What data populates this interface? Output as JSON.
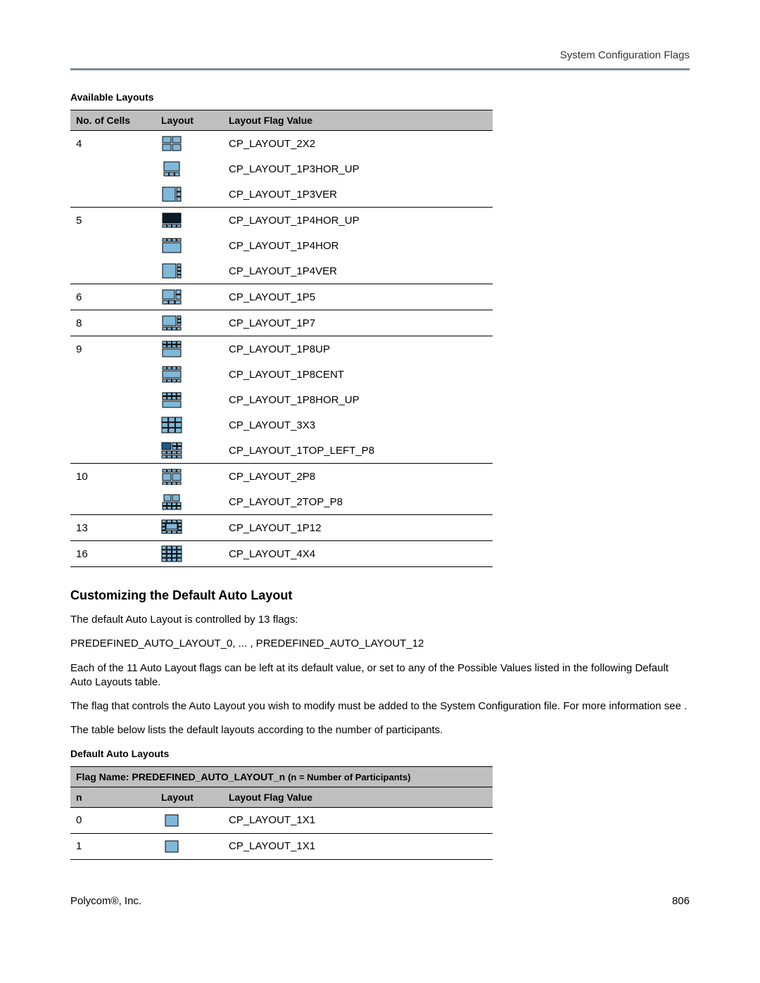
{
  "header": {
    "section": "System Configuration Flags"
  },
  "table1": {
    "caption": "Available Layouts",
    "columns": [
      "No. of Cells",
      "Layout",
      "Layout Flag Value"
    ],
    "rows": [
      {
        "cells": "4",
        "icon": "2x2",
        "value": "CP_LAYOUT_2X2",
        "group_last": false
      },
      {
        "cells": "",
        "icon": "1p3hor_up",
        "value": "CP_LAYOUT_1P3HOR_UP",
        "group_last": false
      },
      {
        "cells": "",
        "icon": "1p3ver",
        "value": "CP_LAYOUT_1P3VER",
        "group_last": true
      },
      {
        "cells": "5",
        "icon": "1p4hor_up",
        "value": "CP_LAYOUT_1P4HOR_UP",
        "group_last": false
      },
      {
        "cells": "",
        "icon": "1p4hor",
        "value": "CP_LAYOUT_1P4HOR",
        "group_last": false
      },
      {
        "cells": "",
        "icon": "1p4ver",
        "value": "CP_LAYOUT_1P4VER",
        "group_last": true
      },
      {
        "cells": "6",
        "icon": "1p5",
        "value": "CP_LAYOUT_1P5",
        "group_last": true
      },
      {
        "cells": "8",
        "icon": "1p7",
        "value": "CP_LAYOUT_1P7",
        "group_last": true
      },
      {
        "cells": "9",
        "icon": "1p8up",
        "value": "CP_LAYOUT_1P8UP",
        "group_last": false
      },
      {
        "cells": "",
        "icon": "1p8cent",
        "value": "CP_LAYOUT_1P8CENT",
        "group_last": false
      },
      {
        "cells": "",
        "icon": "1p8hor_up",
        "value": "CP_LAYOUT_1P8HOR_UP",
        "group_last": false
      },
      {
        "cells": "",
        "icon": "3x3",
        "value": "CP_LAYOUT_3X3",
        "group_last": false
      },
      {
        "cells": "",
        "icon": "1topleft_p8",
        "value": "CP_LAYOUT_1TOP_LEFT_P8",
        "group_last": true
      },
      {
        "cells": "10",
        "icon": "2p8",
        "value": "CP_LAYOUT_2P8",
        "group_last": false
      },
      {
        "cells": "",
        "icon": "2top_p8",
        "value": "CP_LAYOUT_2TOP_P8",
        "group_last": true
      },
      {
        "cells": "13",
        "icon": "1p12",
        "value": "CP_LAYOUT_1P12",
        "group_last": true
      },
      {
        "cells": "16",
        "icon": "4x4",
        "value": "CP_LAYOUT_4X4",
        "group_last": true
      }
    ]
  },
  "section": {
    "heading": "Customizing the Default Auto Layout",
    "paragraphs": [
      "The default Auto Layout is controlled by 13 flags:",
      "PREDEFINED_AUTO_LAYOUT_0, ... , PREDEFINED_AUTO_LAYOUT_12",
      "Each of the 11 Auto Layout flags can be left at its default value, or set to any of the Possible Values listed in the following Default Auto Layouts table.",
      "The flag that controls the Auto Layout you wish to modify must be added to the System Configuration file. For more information see .",
      "The table below lists the default layouts according to the number of participants."
    ]
  },
  "table2": {
    "caption": "Default Auto Layouts",
    "title_prefix": "Flag Name:",
    "title_bold": "PREDEFINED_AUTO_LAYOUT_n",
    "title_suffix": "(n = Number of Participants)",
    "columns": [
      "n",
      "Layout",
      "Layout Flag Value"
    ],
    "rows": [
      {
        "cells": "0",
        "icon": "1x1",
        "value": "CP_LAYOUT_1X1"
      },
      {
        "cells": "1",
        "icon": "1x1",
        "value": "CP_LAYOUT_1X1"
      }
    ]
  },
  "footer": {
    "company": "Polycom®, Inc.",
    "page": "806"
  }
}
